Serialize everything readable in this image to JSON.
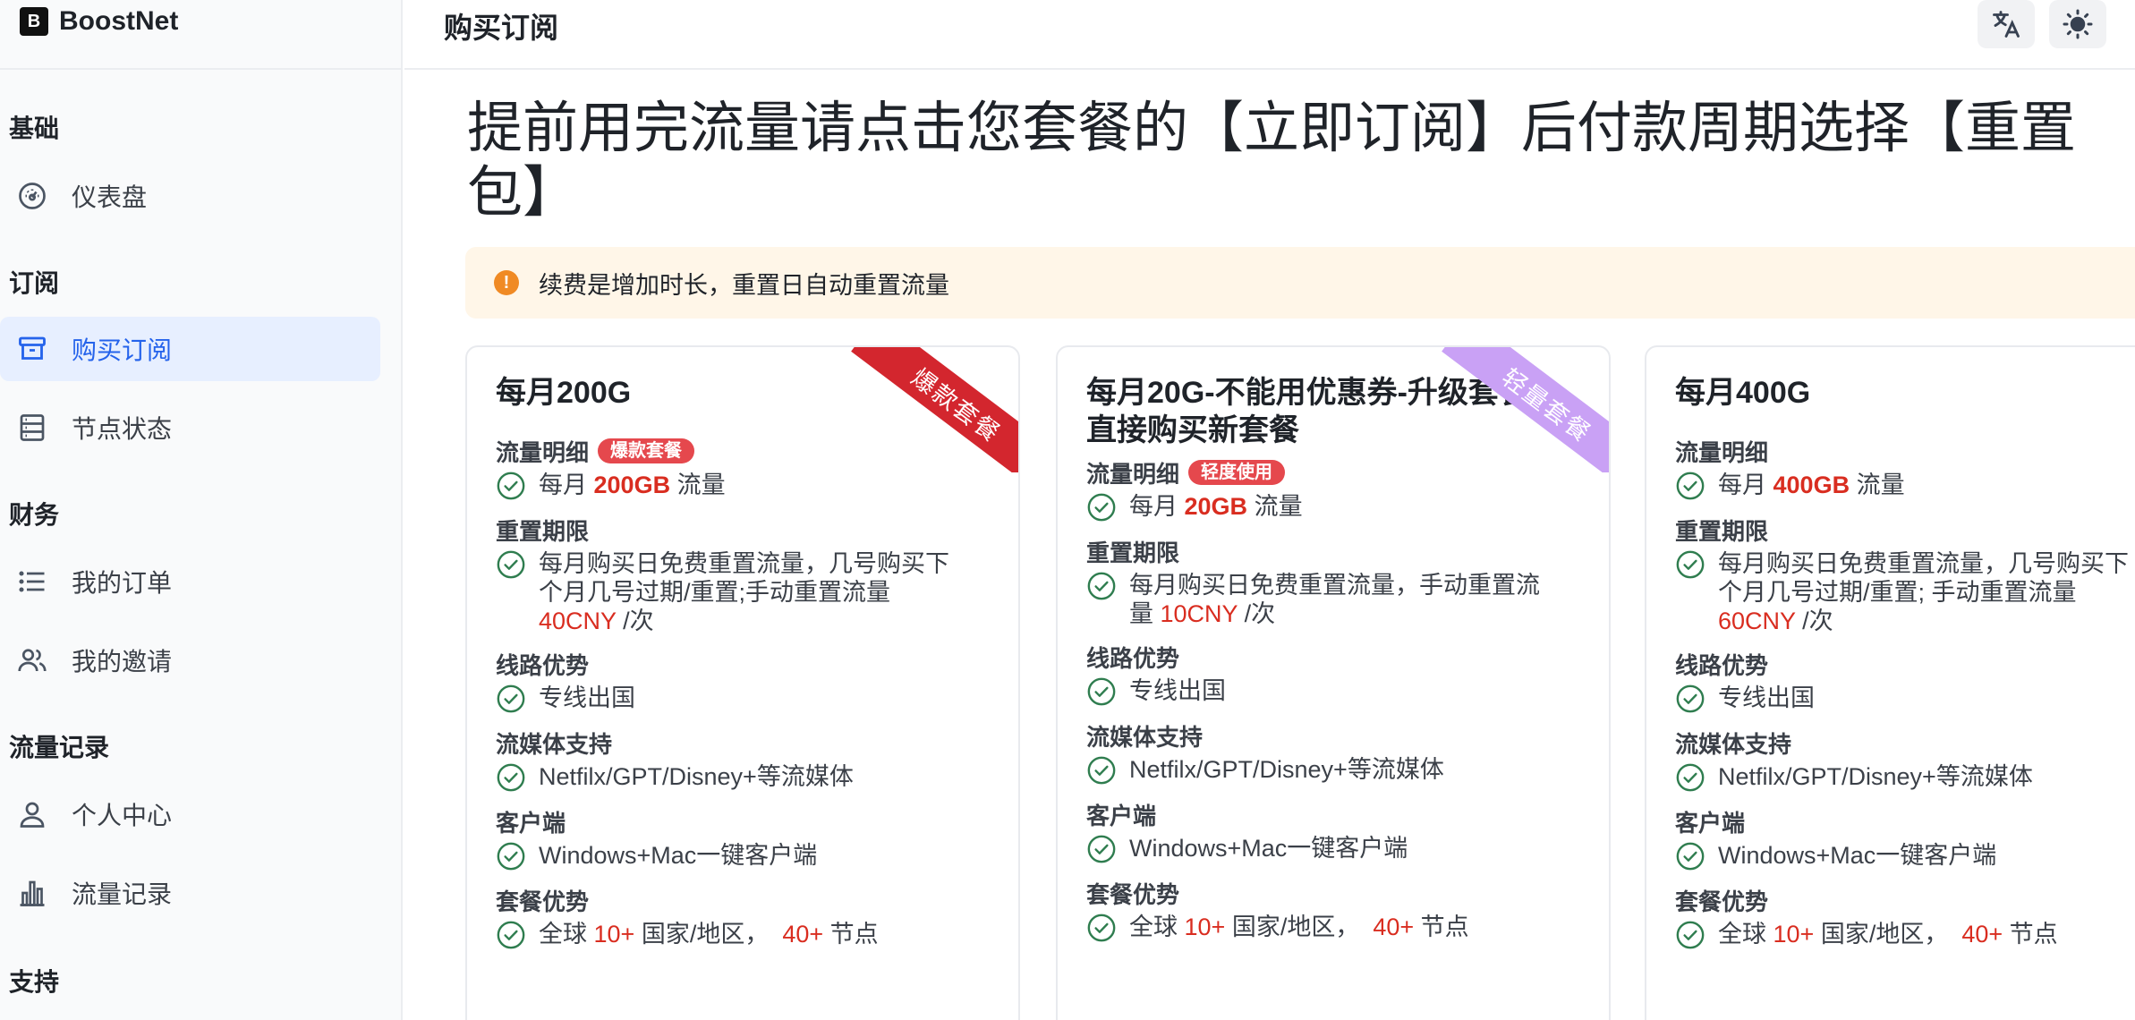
{
  "app": {
    "name": "BoostNet",
    "logo_glyph": "B"
  },
  "header": {
    "title": "购买订阅",
    "translate_icon": "translate-icon",
    "theme_icon": "sun-icon"
  },
  "sidebar": {
    "sections": [
      {
        "title": "基础",
        "items": [
          {
            "label": "仪表盘",
            "icon": "dashboard-icon"
          }
        ]
      },
      {
        "title": "订阅",
        "items": [
          {
            "label": "购买订阅",
            "icon": "store-icon",
            "active": true
          },
          {
            "label": "节点状态",
            "icon": "server-icon"
          }
        ]
      },
      {
        "title": "财务",
        "items": [
          {
            "label": "我的订单",
            "icon": "list-icon"
          },
          {
            "label": "我的邀请",
            "icon": "users-icon"
          }
        ]
      },
      {
        "title": "流量记录",
        "items": [
          {
            "label": "个人中心",
            "icon": "user-icon"
          },
          {
            "label": "流量记录",
            "icon": "bar-chart-icon"
          }
        ]
      },
      {
        "title": "支持",
        "items": []
      }
    ]
  },
  "main": {
    "headline_line1": "提前用完流量请点击您套餐的【立即订阅】后付款周期选择【重置",
    "headline_line2": "包】",
    "alert": {
      "icon": "alert-icon",
      "text": "续费是增加时长，重置日自动重置流量"
    }
  },
  "colors": {
    "accent": "#2563eb",
    "danger": "#d92d20",
    "check": "#2f7d4f",
    "ribbon_red": "#d3262e",
    "ribbon_purple": "#c9a1f5"
  },
  "cards": [
    {
      "title": "每月200G",
      "ribbon": "爆款套餐",
      "traffic_label": "流量明细",
      "traffic_badge": "爆款套餐",
      "traffic_pre": "每月 ",
      "traffic_value": "200GB",
      "traffic_post": " 流量",
      "reset_label": "重置期限",
      "reset_text_l1": "每月购买日免费重置流量，几号购买下",
      "reset_text_l2": "个月几号过期/重置;手动重置流量",
      "reset_price": "40CNY",
      "reset_suffix": " /次",
      "route_label": "线路优势",
      "route_text": "专线出国",
      "media_label": "流媒体支持",
      "media_text": "Netfilx/GPT/Disney+等流媒体",
      "client_label": "客户端",
      "client_text": "Windows+Mac一键客户端",
      "adv_label": "套餐优势",
      "adv_pre": "全球 ",
      "adv_countries": "10+",
      "adv_mid": " 国家/地区，  ",
      "adv_nodes": "40+",
      "adv_post": " 节点"
    },
    {
      "title": "每月20G-不能用优惠券-升级套餐直接购买新套餐",
      "ribbon": "轻量套餐",
      "traffic_label": "流量明细",
      "traffic_badge": "轻度使用",
      "traffic_pre": "每月 ",
      "traffic_value": "20GB",
      "traffic_post": " 流量",
      "reset_label": "重置期限",
      "reset_text_l1": "每月购买日免费重置流量，手动重置流",
      "reset_text_l2": "量 ",
      "reset_price": "10CNY",
      "reset_suffix": " /次",
      "route_label": "线路优势",
      "route_text": "专线出国",
      "media_label": "流媒体支持",
      "media_text": "Netfilx/GPT/Disney+等流媒体",
      "client_label": "客户端",
      "client_text": "Windows+Mac一键客户端",
      "adv_label": "套餐优势",
      "adv_pre": "全球 ",
      "adv_countries": "10+",
      "adv_mid": " 国家/地区，  ",
      "adv_nodes": "40+",
      "adv_post": " 节点"
    },
    {
      "title": "每月400G",
      "ribbon": "",
      "traffic_label": "流量明细",
      "traffic_badge": "",
      "traffic_pre": "每月 ",
      "traffic_value": "400GB",
      "traffic_post": " 流量",
      "reset_label": "重置期限",
      "reset_text_l1": "每月购买日免费重置流量，几号购买下",
      "reset_text_l2": "个月几号过期/重置; 手动重置流量",
      "reset_price": "60CNY",
      "reset_suffix": " /次",
      "route_label": "线路优势",
      "route_text": "专线出国",
      "media_label": "流媒体支持",
      "media_text": "Netfilx/GPT/Disney+等流媒体",
      "client_label": "客户端",
      "client_text": "Windows+Mac一键客户端",
      "adv_label": "套餐优势",
      "adv_pre": "全球 ",
      "adv_countries": "10+",
      "adv_mid": " 国家/地区，  ",
      "adv_nodes": "40+",
      "adv_post": " 节点"
    }
  ]
}
